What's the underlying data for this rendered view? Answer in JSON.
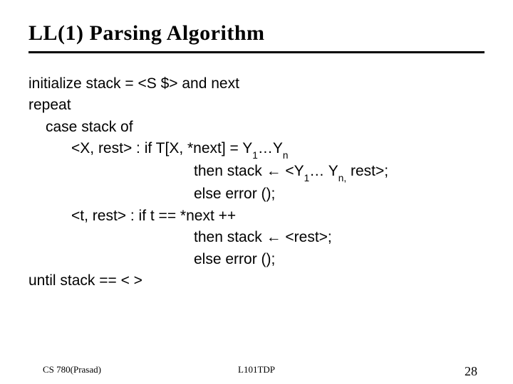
{
  "title": "LL(1) Parsing Algorithm",
  "lines": {
    "l1_a": "initialize",
    "l1_b": " stack = <S $> ",
    "l1_c": "and",
    "l1_d": " next",
    "l2": "repeat",
    "l3_a": "case",
    "l3_b": " stack ",
    "l3_c": "of",
    "l4_a": "<X, rest>  : ",
    "l4_b": "if",
    "l4_c": "  T[X, *next] = Y",
    "l4_d": "…Y",
    "l5_a": "then",
    "l5_b": " stack ",
    "l5_arrow": "←",
    "l5_c": " <Y",
    "l5_d": "… Y",
    "l5_e": " rest>;",
    "l6_a": "else",
    "l6_b": "  error ();",
    "l7_a": "<t, rest>   : ",
    "l7_b": "if",
    "l7_c": "  t == *next ++",
    "l8_a": "then",
    "l8_b": " stack ",
    "l8_arrow": "←",
    "l8_c": " <rest>;",
    "l9_a": "else",
    "l9_b": "  error ();",
    "l10_a": "until",
    "l10_b": " stack == < >"
  },
  "sub": {
    "one": "1",
    "n": "n",
    "ncomma": "n,"
  },
  "footer": {
    "left": "CS 780(Prasad)",
    "center": "L101TDP",
    "right": "28"
  }
}
